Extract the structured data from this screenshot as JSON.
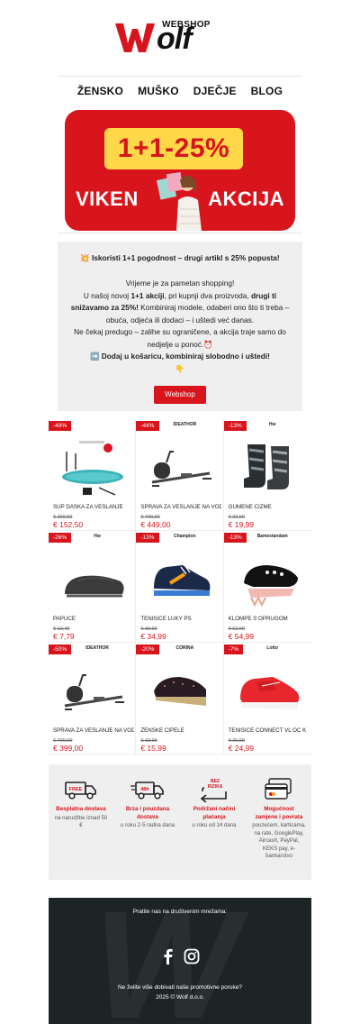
{
  "header": {
    "logo_sub": "WEBSHOP",
    "logo_word": "olf",
    "nav": [
      "ŽENSKO",
      "MUŠKO",
      "DJEČJE",
      "BLOG"
    ]
  },
  "banner": {
    "promo": "1+1-25%",
    "title_left": "VIKEN",
    "title_right": "AKCIJA",
    "accent": "#d8141c",
    "highlight": "#ffd84a"
  },
  "promo": {
    "lead": "💥 Iskoristi 1+1 pogodnost – drugi artikl s 25% popusta!",
    "line1": "Vrijeme je za pametan shopping!",
    "line2a": "U našoj novoj ",
    "line2b": "1+1 akciji",
    "line2c": ", pri kupnji dva proizvoda, ",
    "line2d": "drugi ti snižavamo za 25%!",
    "line2e": " Kombiniraj modele, odaberi ono što ti treba – obuća, odjeća ili dodaci – i uštedi već danas.",
    "line3": "Ne čekaj predugo – zalihe su ograničene, a akcija traje samo do nedjelje u ponoć.⏰",
    "line4": "➡️ Dodaj u košaricu, kombiniraj slobodno i uštedi!",
    "line5": "👇",
    "button": "Webshop"
  },
  "products": [
    {
      "discount": "-49%",
      "brand": "",
      "name": "SUP DASKA ZA VESLANJE",
      "old_price": "€ 299,99",
      "price": "€ 152,50",
      "icon": "paddle-board-icon"
    },
    {
      "discount": "-44%",
      "brand": "IDEATHOR",
      "name": "SPRAVA ZA VESLANJE NA VODU",
      "old_price": "€ 799,00",
      "price": "€ 449,00",
      "icon": "rowing-machine-icon"
    },
    {
      "discount": "-13%",
      "brand": "Hw",
      "name": "GUMENE ČIZME",
      "old_price": "€ 22,99",
      "price": "€ 19,99",
      "icon": "rain-boots-icon"
    },
    {
      "discount": "-26%",
      "brand": "Hw",
      "name": "PAPUČE",
      "old_price": "€ 10,49",
      "price": "€ 7,79",
      "icon": "slipper-icon"
    },
    {
      "discount": "-13%",
      "brand": "Champion",
      "name": "TENISICE LUKY PS",
      "old_price": "€ 39,99",
      "price": "€ 34,99",
      "icon": "sneaker-icon"
    },
    {
      "discount": "-13%",
      "brand": "Bamestandam",
      "name": "KLOMPE S OPRUGOM",
      "old_price": "€ 62,99",
      "price": "€ 54,99",
      "icon": "clog-icon"
    },
    {
      "discount": "-50%",
      "brand": "IDEATHOR",
      "name": "SPRAVA ZA VESLANJE NA VODU",
      "old_price": "€ 799,00",
      "price": "€ 399,00",
      "icon": "rowing-machine-icon"
    },
    {
      "discount": "-20%",
      "brand": "CORINA",
      "name": "ŽENSKE CIPELE",
      "old_price": "€ 19,99",
      "price": "€ 15,99",
      "icon": "wedge-shoe-icon"
    },
    {
      "discount": "-7%",
      "brand": "Lotto",
      "name": "TENISICE CONNECT VL OC K",
      "old_price": "€ 26,99",
      "price": "€ 24,99",
      "icon": "red-sneaker-icon"
    }
  ],
  "features": [
    {
      "title": "Besplatna dostava",
      "sub": "na narudžbe iznad 50 €",
      "icon": "free-delivery-truck-icon",
      "icon_text": "FREE"
    },
    {
      "title": "Brza i pouzdana dostava",
      "sub": "u roku 2-5 radna dana",
      "icon": "fast-delivery-truck-icon",
      "icon_text": "48h"
    },
    {
      "title": "Podržani načini plaćanja",
      "sub": "u roku od 14 dana",
      "icon": "return-arrow-icon",
      "icon_text": "BEZ RIZIKA"
    },
    {
      "title": "Mogućnost zamjene i povrata",
      "sub": "pouzećem, karticama, na rate, GooglePlay, Aircash, PayPal, KEKS pay, e-bankarstvo",
      "icon": "payment-cards-icon",
      "icon_text": ""
    }
  ],
  "footer": {
    "follow": "Pratite nas na društvenim mrežama:",
    "unsubscribe": "Ne želite više dobivati naše promotivne poruke?",
    "copyright": "2025 © Wolf d.o.o."
  }
}
